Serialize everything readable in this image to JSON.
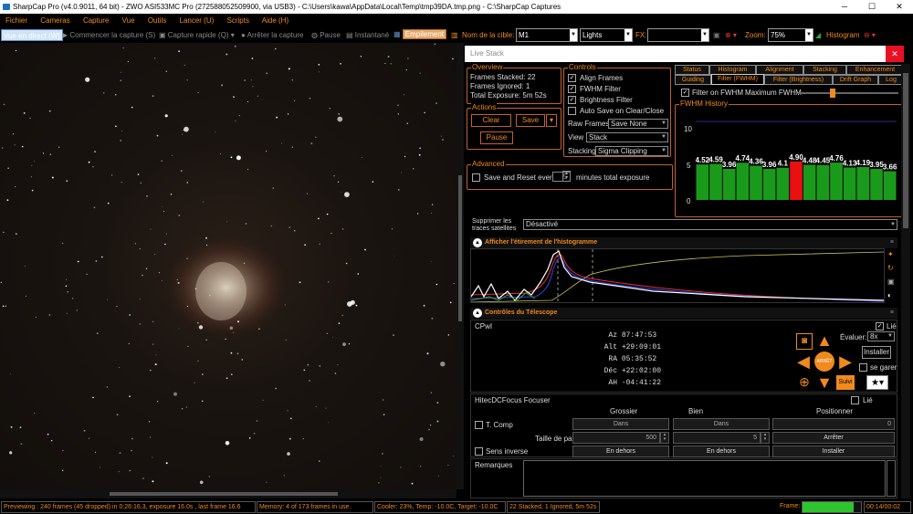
{
  "window": {
    "title": "SharpCap Pro (v4.0.9011, 64 bit) - ZWO ASI533MC Pro (272588052509900, via USB3) - C:\\Users\\kawa\\AppData\\Local\\Temp\\tmp39DA.tmp.png - C:\\SharpCap Captures",
    "min": "─",
    "max": "☐",
    "close": "✕"
  },
  "menu": [
    "Fichier",
    "Cameras",
    "Capture",
    "Vue",
    "Outils",
    "Lancer (U)",
    "Scripts",
    "Aide (H)"
  ],
  "toolbar": {
    "live_view": "Vue en direct (W)",
    "start_capture": "Commencer la capture (S)",
    "quick_capture": "Capture rapide (Q)",
    "stop_capture": "Arrêter la capture",
    "pause": "Pause",
    "snapshot": "Instantané",
    "stacking": "Empilement",
    "target_label": "Nom de la cible:",
    "target_value": "M1",
    "frame_type": "Lights",
    "fx_label": "FX:",
    "zoom_label": "Zoom:",
    "zoom_value": "75%",
    "histogram": "Histogram"
  },
  "live_stack": {
    "title": "Live Stack",
    "close": "✕",
    "overview": {
      "label": "Overview",
      "frames_stacked": "Frames Stacked: 22",
      "frames_ignored": "Frames Ignored: 1",
      "total_exposure": "Total Exposure: 5m 52s"
    },
    "actions": {
      "label": "Actions",
      "clear": "Clear",
      "save": "Save",
      "pause": "Pause"
    },
    "controls": {
      "label": "Controls",
      "align": "Align Frames",
      "fwhm": "FWHM Filter",
      "brightness": "Brightness Filter",
      "autosave": "Auto Save on Clear/Close",
      "raw_frames_label": "Raw Frames",
      "raw_frames_value": "Save None",
      "view_label": "View",
      "view_value": "Stack",
      "stacking_label": "Stacking",
      "stacking_value": "Sigma Clipping"
    },
    "advanced": {
      "label": "Advanced",
      "save_reset": "Save and Reset every",
      "value": "5",
      "suffix": "minutes total exposure"
    },
    "tabs_row1": [
      "Status",
      "Histogram",
      "Alignment",
      "Stacking",
      "Enhancement"
    ],
    "tabs_row2": [
      "Guiding",
      "Filter (FWHM)",
      "Filter (Brightness)",
      "Drift Graph",
      "Log"
    ],
    "filter_on": "Filter on FWHM",
    "max_fwhm": "Maximum FWHM",
    "history_label": "FWHM History",
    "y_ticks": [
      "10",
      "5",
      "0"
    ],
    "bars": [
      {
        "v": 4.52,
        "l": "4.52"
      },
      {
        "v": 4.59,
        "l": "4.59"
      },
      {
        "v": 3.96,
        "l": "3.96"
      },
      {
        "v": 4.74,
        "l": "4.74"
      },
      {
        "v": 4.36,
        "l": "4.36"
      },
      {
        "v": 3.96,
        "l": "3.96"
      },
      {
        "v": 4.1,
        "l": "4.1"
      },
      {
        "v": 4.9,
        "l": "4.90",
        "rejected": true
      },
      {
        "v": 4.48,
        "l": "4.48"
      },
      {
        "v": 4.45,
        "l": "4.45"
      },
      {
        "v": 4.76,
        "l": "4.76"
      },
      {
        "v": 4.13,
        "l": "4.13"
      },
      {
        "v": 4.19,
        "l": "4.19"
      },
      {
        "v": 3.95,
        "l": "3.95"
      },
      {
        "v": 3.66,
        "l": "3.66"
      }
    ]
  },
  "sat": {
    "label": "Supprimer les traces satellites",
    "value": "Désactivé"
  },
  "histo_section": "Afficher l'étirement de l'histogramme",
  "telescope": {
    "section": "Contrôles du Télescope",
    "name": "CPwI",
    "lie": "Lié",
    "rows": [
      {
        "k": "Az",
        "v": "87:47:53"
      },
      {
        "k": "Alt",
        "v": "+29:09:01"
      },
      {
        "k": "RA",
        "v": "05:35:52"
      },
      {
        "k": "Déc",
        "v": "+22:02:00"
      },
      {
        "k": "AH",
        "v": "-04:41:22"
      }
    ],
    "evaluer": "Évaluer:",
    "rate": "8x",
    "installer": "Installer",
    "se_garer": "se garer",
    "suivi": "Suivi",
    "stop": "ARRÊT"
  },
  "focuser": {
    "name": "HitecDCFocus Focuser",
    "lie": "Lié",
    "h_coarse": "Grossier",
    "h_fine": "Bien",
    "h_pos": "Positionner",
    "t_comp": "T. Comp",
    "dans": "Dans",
    "step_label": "Taille de pas",
    "step_coarse": "500",
    "step_fine": "5",
    "pos": "0",
    "arreter": "Arrêter",
    "sens": "Sens inverse",
    "en_dehors": "En dehors",
    "installer": "Installer"
  },
  "remarks": "Remarques",
  "status": {
    "preview": "Previewing : 240 frames (45 dropped) in 0:26:16,3, exposure 16.0s , last frame 16.6",
    "memory": "Memory: 4 of 173 frames in use.",
    "cooler": "Cooler: 23%, Temp: -10.0C, Target: -10.0C",
    "stacked": "22 Stacked, 1 Ignored, 5m 52s",
    "frame_label": "Frame:",
    "frame_progress": 0.85,
    "time": "00:14/00:02"
  },
  "colors": {
    "accent": "#f08a1c",
    "border": "#c0622a",
    "bar_ok": "#1a9a1a",
    "bar_bad": "#e81010"
  }
}
